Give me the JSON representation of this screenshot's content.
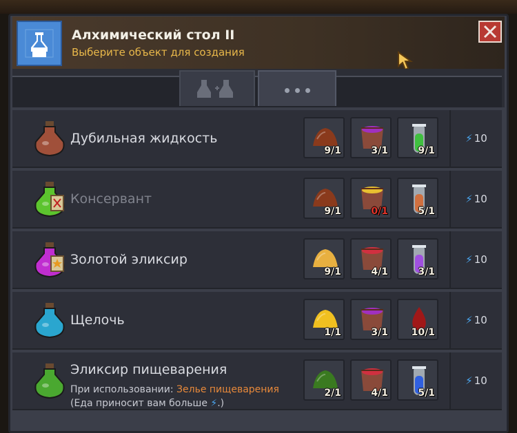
{
  "window": {
    "title": "Алхимический стол II",
    "subtitle": "Выберите объект для создания"
  },
  "tabs": [
    {
      "name": "recipes-tab",
      "icon": "flasks-icon"
    },
    {
      "name": "more-tab",
      "icon": "more-dots-icon"
    }
  ],
  "recipes": [
    {
      "name": "Дубильная жидкость",
      "disabled": false,
      "potion_color": "#a0503a",
      "ingredients": [
        {
          "icon": "brown-powder-icon",
          "qty": "9/1",
          "ok": true
        },
        {
          "icon": "purple-pot-icon",
          "qty": "3/1",
          "ok": true
        },
        {
          "icon": "green-vial-icon",
          "qty": "9/1",
          "ok": true
        }
      ],
      "energy": "10"
    },
    {
      "name": "Консервант",
      "disabled": true,
      "potion_color": "#5cc42e",
      "ingredients": [
        {
          "icon": "brown-powder-icon",
          "qty": "9/1",
          "ok": true
        },
        {
          "icon": "yellow-pot-icon",
          "qty": "0/1",
          "ok": false
        },
        {
          "icon": "orange-vial-icon",
          "qty": "5/1",
          "ok": true
        }
      ],
      "energy": "10"
    },
    {
      "name": "Золотой эликсир",
      "disabled": false,
      "potion_color": "#c02ed0",
      "ingredients": [
        {
          "icon": "gold-powder-icon",
          "qty": "9/1",
          "ok": true
        },
        {
          "icon": "red-pot-icon",
          "qty": "4/1",
          "ok": true
        },
        {
          "icon": "purple-vial-icon",
          "qty": "3/1",
          "ok": true
        }
      ],
      "energy": "10"
    },
    {
      "name": "Щелочь",
      "disabled": false,
      "potion_color": "#2aa6cf",
      "ingredients": [
        {
          "icon": "yellow-powder-icon",
          "qty": "1/1",
          "ok": true
        },
        {
          "icon": "purple-pot-icon",
          "qty": "3/1",
          "ok": true
        },
        {
          "icon": "blood-drop-icon",
          "qty": "10/1",
          "ok": true
        }
      ],
      "energy": "10"
    },
    {
      "name": "Эликсир пищеварения",
      "disabled": false,
      "potion_color": "#4aa830",
      "description": {
        "prefix": "При использовании: ",
        "highlight": "Зелье пищеварения",
        "suffix": " (Еда приносит вам больше ",
        "end": ".)"
      },
      "ingredients": [
        {
          "icon": "green-powder-icon",
          "qty": "2/1",
          "ok": true
        },
        {
          "icon": "red-pot-icon",
          "qty": "4/1",
          "ok": true
        },
        {
          "icon": "blue-vial-icon",
          "qty": "5/1",
          "ok": true
        }
      ],
      "energy": "10"
    }
  ]
}
